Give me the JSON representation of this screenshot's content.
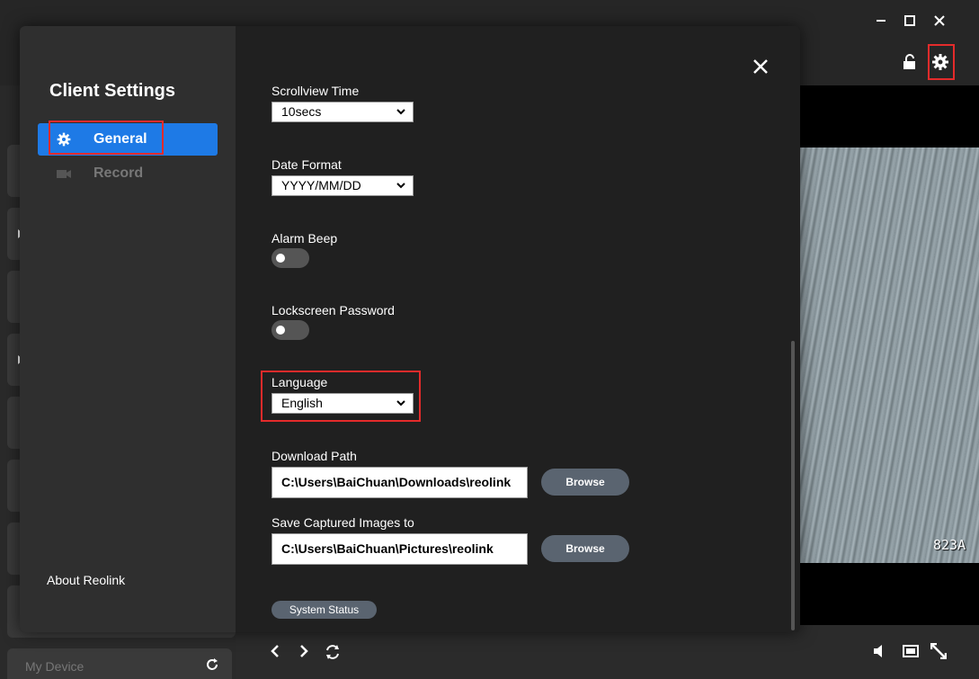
{
  "window": {
    "minimize_icon": "minimize-icon",
    "maximize_icon": "maximize-icon",
    "close_icon": "close-icon"
  },
  "toolbar": {
    "lock_icon": "unlock-icon",
    "settings_icon": "gear-icon"
  },
  "video": {
    "label": "823A"
  },
  "bottom_bar": {
    "icons": [
      "chevron-left-icon",
      "chevron-right-icon",
      "refresh-icon",
      "speaker-icon",
      "screen-icon",
      "fullscreen-icon"
    ]
  },
  "sidebar": {
    "my_device_label": "My Device"
  },
  "modal": {
    "title": "Client Settings",
    "nav": [
      {
        "label": "General",
        "icon": "gear-icon",
        "active": true
      },
      {
        "label": "Record",
        "icon": "video-camera-icon",
        "active": false
      }
    ],
    "about_label": "About Reolink"
  },
  "settings": {
    "scrollview_time": {
      "label": "Scrollview Time",
      "value": "10secs"
    },
    "date_format": {
      "label": "Date Format",
      "value": "YYYY/MM/DD"
    },
    "alarm_beep": {
      "label": "Alarm Beep",
      "enabled": false
    },
    "lockscreen_password": {
      "label": "Lockscreen Password",
      "enabled": false
    },
    "language": {
      "label": "Language",
      "value": "English"
    },
    "download_path": {
      "label": "Download Path",
      "value": "C:\\Users\\BaiChuan\\Downloads\\reolink",
      "button": "Browse"
    },
    "captured_images": {
      "label": "Save Captured Images to",
      "value": "C:\\Users\\BaiChuan\\Pictures\\reolink",
      "button": "Browse"
    },
    "system_status_button": "System Status"
  },
  "colors": {
    "accent": "#1e7ae6",
    "highlight": "#e42b2b",
    "modal_bg": "#202020",
    "sidebar_bg": "#2f2f2f",
    "button_bg": "#5a6470"
  }
}
